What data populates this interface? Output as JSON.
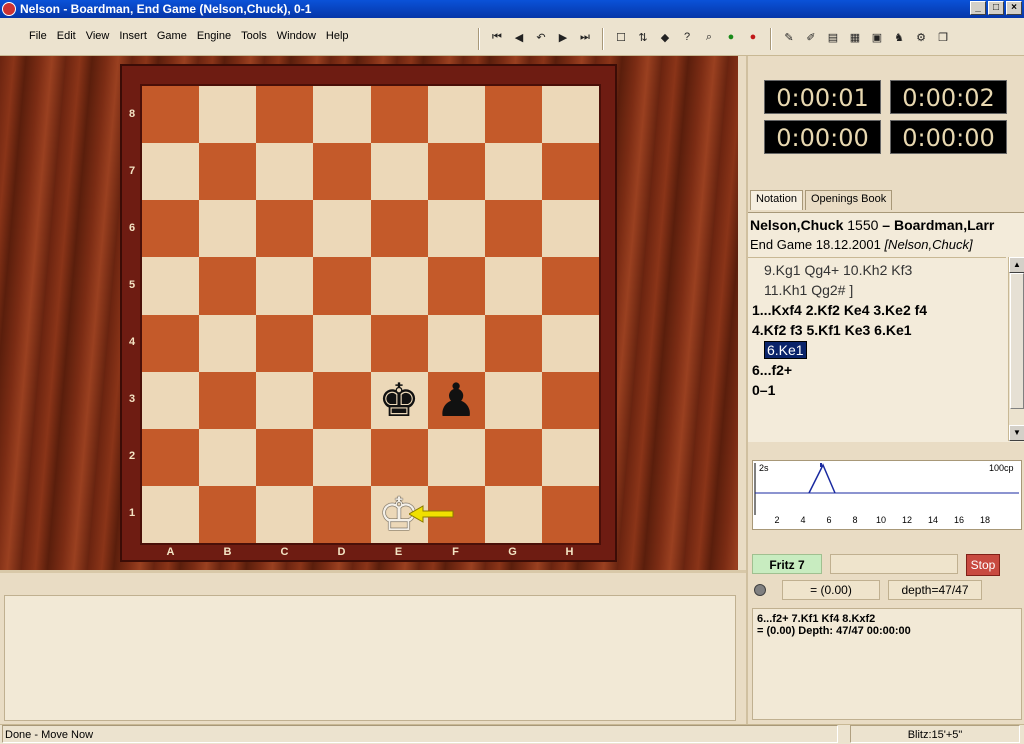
{
  "window": {
    "title": "Nelson - Boardman, End Game  (Nelson,Chuck), 0-1",
    "min": "_",
    "max": "□",
    "close": "×"
  },
  "menu": [
    "File",
    "Edit",
    "View",
    "Insert",
    "Game",
    "Engine",
    "Tools",
    "Window",
    "Help"
  ],
  "board": {
    "ranks": [
      "8",
      "7",
      "6",
      "5",
      "4",
      "3",
      "2",
      "1"
    ],
    "files": [
      "A",
      "B",
      "C",
      "D",
      "E",
      "F",
      "G",
      "H"
    ],
    "pieces": [
      {
        "glyph": "♚",
        "square": "e3",
        "color": "#111"
      },
      {
        "glyph": "♟",
        "square": "f3",
        "color": "#111"
      },
      {
        "glyph": "♔",
        "square": "e1",
        "color": "#f4f0e8"
      }
    ],
    "arrow_color": "#f0e000"
  },
  "clocks": [
    "0:00:01",
    "0:00:02",
    "0:00:00",
    "0:00:00"
  ],
  "tabs": [
    "Notation",
    "Openings Book"
  ],
  "game": {
    "white": "Nelson,Chuck",
    "white_elo": "1550",
    "dash": "–",
    "black": "Boardman,Larr",
    "event_prefix": "End Game 18.12.2001 ",
    "annotator": "[Nelson,Chuck]"
  },
  "moves": {
    "var1": "9.Kg1 Qg4+ 10.Kh2 Kf3",
    "var2": "11.Kh1 Qg2# ]",
    "main1": "1...Kxf4  2.Kf2  Ke4  3.Ke2  f4",
    "main2": "4.Kf2  f3  5.Kf1  Ke3  6.Ke1",
    "current": "6.Ke1",
    "main3": "6...f2+",
    "result": "0–1"
  },
  "graph": {
    "ylabel_left": "2s",
    "ylabel_right": "100cp",
    "xticks": [
      "2",
      "4",
      "6",
      "8",
      "10",
      "12",
      "14",
      "16",
      "18"
    ]
  },
  "engine": {
    "name": "Fritz 7",
    "stop": "Stop",
    "eval": "= (0.00)",
    "depth": "depth=47/47",
    "line1": "6...f2+ 7.Kf1 Kf4 8.Kxf2",
    "line2": "=  (0.00)    Depth: 47/47    00:00:00"
  },
  "status": {
    "left": "Done - Move Now",
    "right": "Blitz:15'+5\""
  }
}
